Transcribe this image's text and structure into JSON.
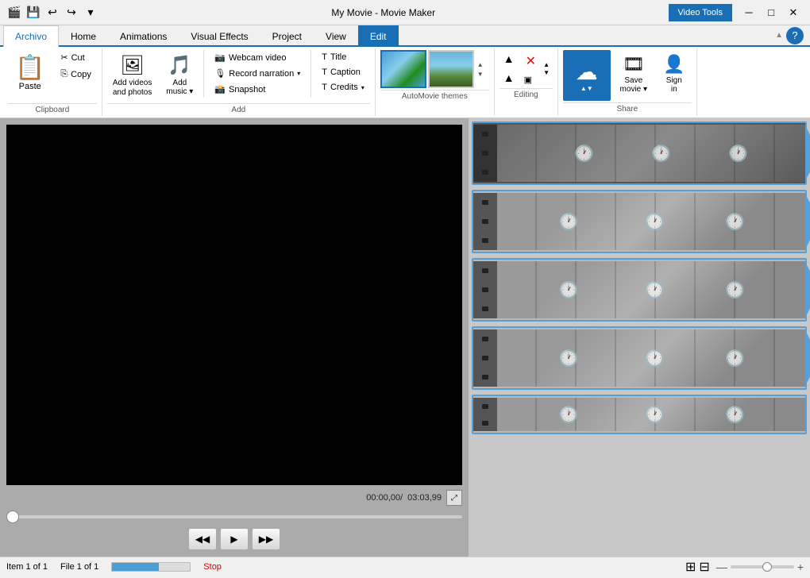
{
  "titleBar": {
    "title": "My Movie - Movie Maker",
    "videoBadge": "Video Tools",
    "icons": [
      "❐",
      "💾",
      "↩",
      "↪",
      "✓"
    ]
  },
  "tabs": [
    {
      "id": "archivo",
      "label": "Archivo",
      "active": true
    },
    {
      "id": "home",
      "label": "Home"
    },
    {
      "id": "animations",
      "label": "Animations"
    },
    {
      "id": "visualEffects",
      "label": "Visual Effects"
    },
    {
      "id": "project",
      "label": "Project"
    },
    {
      "id": "view",
      "label": "View"
    },
    {
      "id": "edit",
      "label": "Edit",
      "highlighted": true
    }
  ],
  "ribbon": {
    "groups": {
      "clipboard": {
        "label": "Clipboard",
        "paste": "Paste",
        "cut": "Cut",
        "copy": "Copy"
      },
      "add": {
        "label": "Add",
        "addVideos": "Add videos\nand photos",
        "addMusic": "Add\nmusic",
        "webcamVideo": "Webcam video",
        "recordNarration": "Record narration",
        "snapshot": "Snapshot",
        "title": "Title",
        "caption": "Caption",
        "credits": "Credits"
      },
      "autoMovieThemes": {
        "label": "AutoMovie themes"
      },
      "editing": {
        "label": "Editing"
      },
      "share": {
        "label": "Share",
        "saveMovie": "Save\nmovie",
        "signIn": "Sign\nin"
      }
    }
  },
  "preview": {
    "currentTime": "00:00,00",
    "totalTime": "03:03,99",
    "playBtn": "▶",
    "prevBtn": "◀◀",
    "nextBtn": "▶▶"
  },
  "statusBar": {
    "item": "Item 1 of 1",
    "file": "File 1 of 1",
    "stop": "Stop",
    "zoomMinus": "—",
    "zoomPlus": "+"
  },
  "filmStrips": [
    {
      "id": 1,
      "type": "first"
    },
    {
      "id": 2,
      "type": "normal"
    },
    {
      "id": 3,
      "type": "normal"
    },
    {
      "id": 4,
      "type": "normal"
    },
    {
      "id": 5,
      "type": "partial"
    }
  ]
}
